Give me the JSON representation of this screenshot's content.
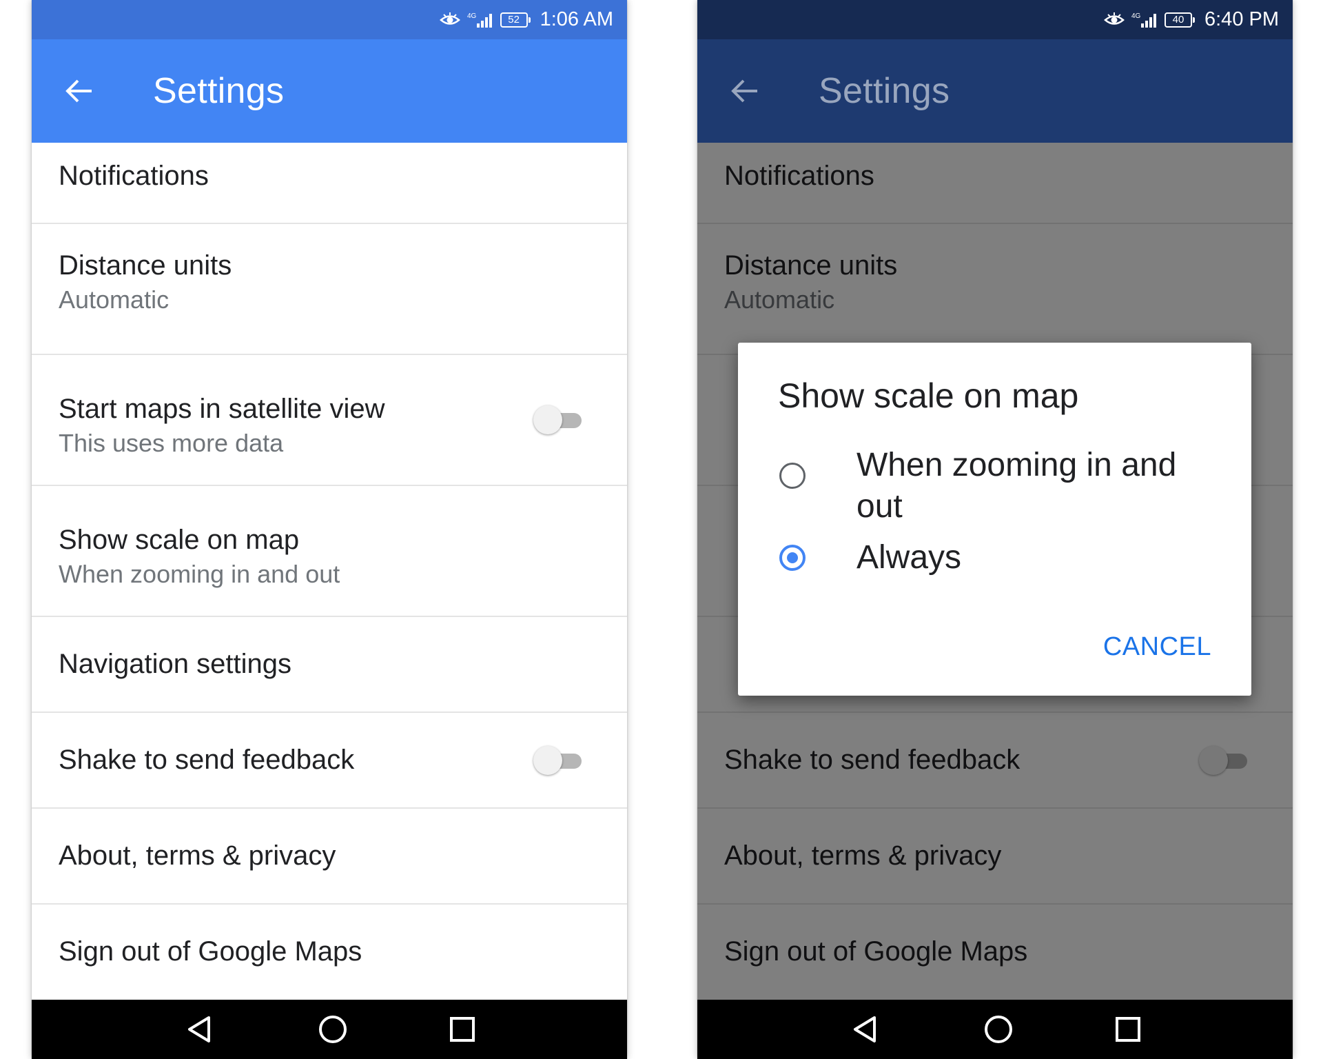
{
  "left_screen": {
    "status_bar": {
      "network": "4G",
      "battery": "52",
      "time": "1:06 AM"
    },
    "app_bar": {
      "title": "Settings"
    },
    "settings": {
      "notifications": "Notifications",
      "distance_units": {
        "title": "Distance units",
        "subtitle": "Automatic"
      },
      "satellite_view": {
        "title": "Start maps in satellite view",
        "subtitle": "This uses more data",
        "enabled": false
      },
      "show_scale": {
        "title": "Show scale on map",
        "subtitle": "When zooming in and out"
      },
      "navigation": "Navigation settings",
      "shake_feedback": {
        "title": "Shake to send feedback",
        "enabled": false
      },
      "about": "About, terms & privacy",
      "sign_out": "Sign out of Google Maps"
    }
  },
  "right_screen": {
    "status_bar": {
      "network": "4G",
      "battery": "40",
      "time": "6:40 PM"
    },
    "app_bar": {
      "title": "Settings"
    },
    "settings": {
      "notifications": "Notifications",
      "distance_units": {
        "title": "Distance units",
        "subtitle": "Automatic"
      },
      "shake_feedback": {
        "title": "Shake to send feedback",
        "enabled": false
      },
      "about": "About, terms & privacy",
      "sign_out": "Sign out of Google Maps"
    },
    "dialog": {
      "title": "Show scale on map",
      "options": [
        {
          "label": "When zooming in and out",
          "selected": false
        },
        {
          "label": "Always",
          "selected": true
        }
      ],
      "cancel_label": "CANCEL"
    }
  },
  "colors": {
    "status_bar_light": "#3c72d7",
    "app_bar_light": "#4285f4",
    "status_bar_dim": "#162a52",
    "app_bar_dim": "#1e3a70",
    "accent": "#1a73e8",
    "nav_bar": "#000000"
  },
  "icons": [
    "back-arrow-icon",
    "eye-icon",
    "signal-icon",
    "battery-icon",
    "nav-back-icon",
    "nav-home-icon",
    "nav-recents-icon"
  ]
}
